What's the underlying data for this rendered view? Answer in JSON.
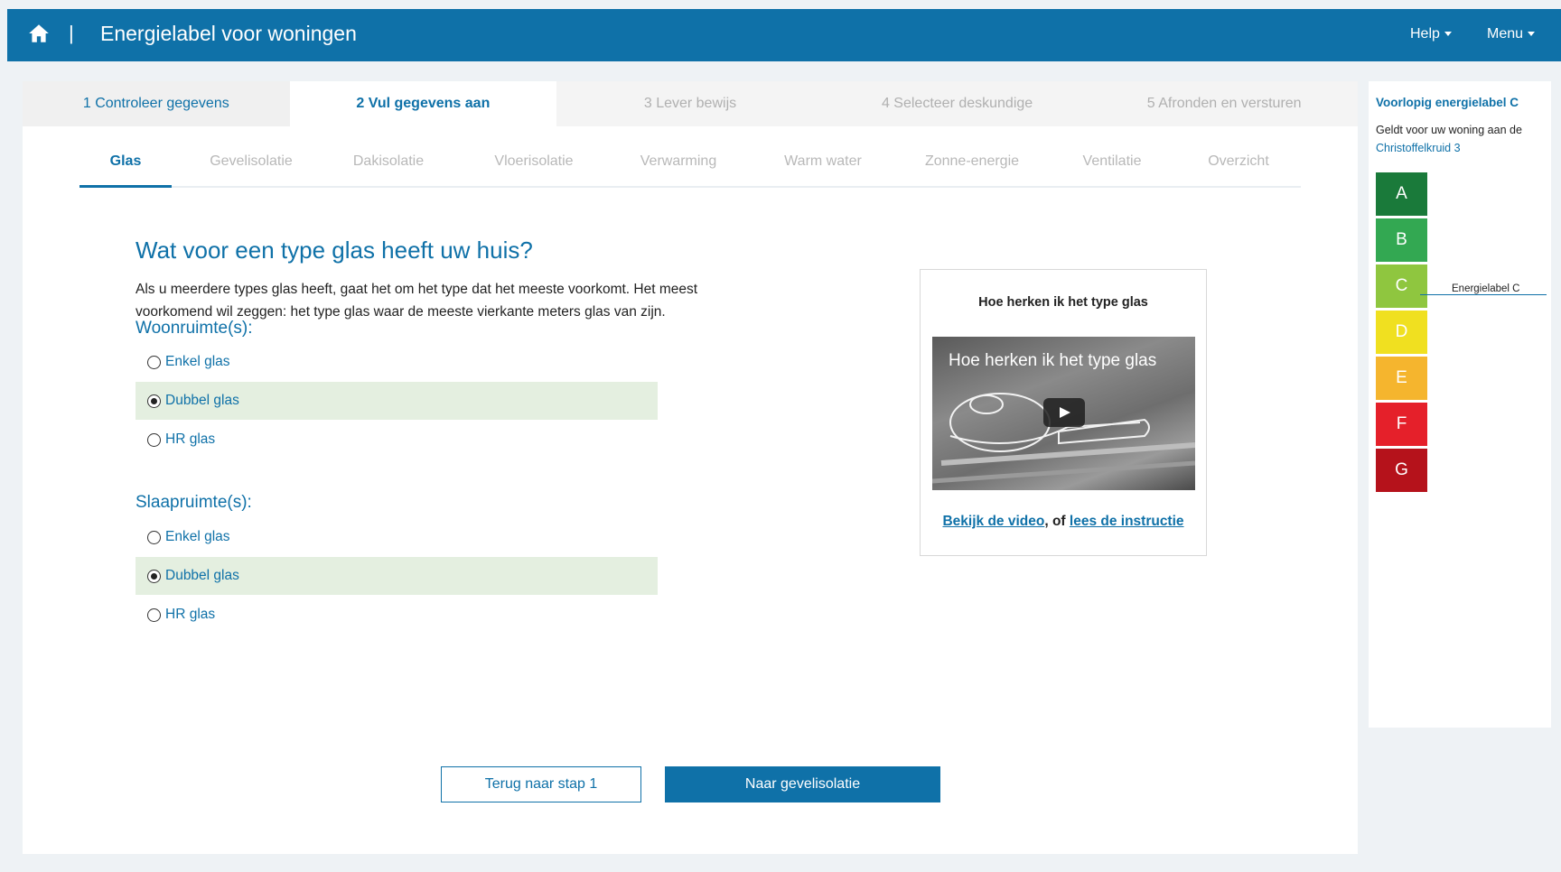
{
  "header": {
    "home_icon": "home-icon",
    "divider": "|",
    "title": "Energielabel voor woningen",
    "help_label": "Help",
    "menu_label": "Menu"
  },
  "steps": [
    {
      "label": "1 Controleer gegevens",
      "state": "done"
    },
    {
      "label": "2 Vul gegevens aan",
      "state": "active"
    },
    {
      "label": "3 Lever bewijs",
      "state": "disabled"
    },
    {
      "label": "4 Selecteer deskundige",
      "state": "disabled"
    },
    {
      "label": "5 Afronden en versturen",
      "state": "disabled"
    }
  ],
  "subtabs": [
    {
      "label": "Glas",
      "active": true
    },
    {
      "label": "Gevelisolatie",
      "active": false
    },
    {
      "label": "Dakisolatie",
      "active": false
    },
    {
      "label": "Vloerisolatie",
      "active": false
    },
    {
      "label": "Verwarming",
      "active": false
    },
    {
      "label": "Warm water",
      "active": false
    },
    {
      "label": "Zonne-energie",
      "active": false
    },
    {
      "label": "Ventilatie",
      "active": false
    },
    {
      "label": "Overzicht",
      "active": false
    }
  ],
  "question": {
    "title": "Wat voor een type glas heeft uw huis?",
    "intro_line1": "Als u meerdere types glas heeft, gaat het om het type dat het meeste voorkomt. Het meest",
    "intro_line2": "voorkomend wil zeggen: het type glas waar de meeste vierkante meters glas van zijn."
  },
  "groups": {
    "woon": {
      "title": "Woonruimte(s):",
      "options": [
        {
          "label": "Enkel glas",
          "selected": false
        },
        {
          "label": "Dubbel glas",
          "selected": true
        },
        {
          "label": "HR glas",
          "selected": false
        }
      ]
    },
    "slaap": {
      "title": "Slaapruimte(s):",
      "options": [
        {
          "label": "Enkel glas",
          "selected": false
        },
        {
          "label": "Dubbel glas",
          "selected": true
        },
        {
          "label": "HR glas",
          "selected": false
        }
      ]
    }
  },
  "video": {
    "box_title": "Hoe herken ik het type glas",
    "thumb_title": "Hoe herken ik het type glas",
    "link_video": "Bekijk de video",
    "separator": ", of ",
    "link_instruction": "lees de instructie"
  },
  "buttons": {
    "back": "Terug naar stap 1",
    "next": "Naar gevelisolatie"
  },
  "side": {
    "title": "Voorlopig energielabel C",
    "text": "Geldt voor uw woning aan de",
    "address": "Christoffelkruid 3",
    "marker_text": "Energielabel C",
    "labels": [
      {
        "letter": "A",
        "color": "#1a7a3a"
      },
      {
        "letter": "B",
        "color": "#33a852"
      },
      {
        "letter": "C",
        "color": "#8fc63f"
      },
      {
        "letter": "D",
        "color": "#f0e020"
      },
      {
        "letter": "E",
        "color": "#f5b52e"
      },
      {
        "letter": "F",
        "color": "#e5202a"
      },
      {
        "letter": "G",
        "color": "#b5121b"
      }
    ]
  }
}
